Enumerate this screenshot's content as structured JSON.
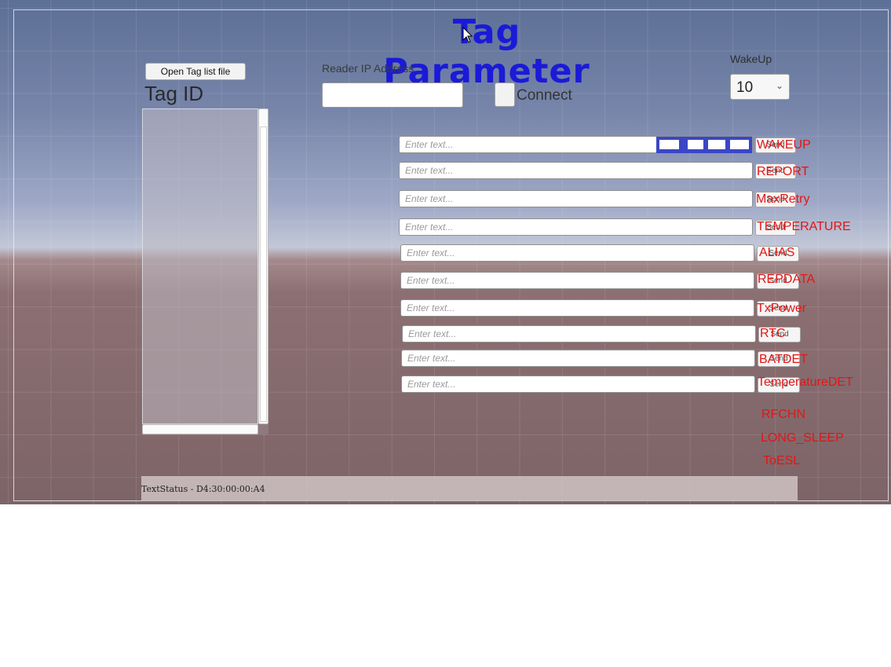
{
  "title": "Tag Parameter",
  "open_button": "Open Tag list file",
  "tag_id_label": "Tag ID",
  "reader_ip": {
    "label": "Reader IP Address",
    "value": ""
  },
  "connect": {
    "label": "Connect",
    "checked": false
  },
  "wakeup": {
    "label": "WakeUp",
    "value": "10"
  },
  "placeholder": "Enter text...",
  "send_label": "Send",
  "commands": [
    {
      "label": "WAKEUP"
    },
    {
      "label": "REPORT"
    },
    {
      "label": "MaxRetry"
    },
    {
      "label": "TEMPERATURE"
    },
    {
      "label": "ALIAS"
    },
    {
      "label": "REPDATA"
    },
    {
      "label": "TxPower"
    },
    {
      "label": "RTC"
    },
    {
      "label": "BATDET"
    },
    {
      "label": "TemperatureDET"
    }
  ],
  "extra_commands": [
    "RFCHN",
    "LONG_SLEEP",
    "ToESL"
  ],
  "status_text": "TextStatus - D4:30:00:00:A4",
  "colors": {
    "title": "#1a1ad8",
    "command_label": "#e41515",
    "selection": "#3a46c6"
  },
  "icons": {
    "cursor": "mouse-pointer-icon",
    "dropdown": "chevron-down-icon"
  }
}
